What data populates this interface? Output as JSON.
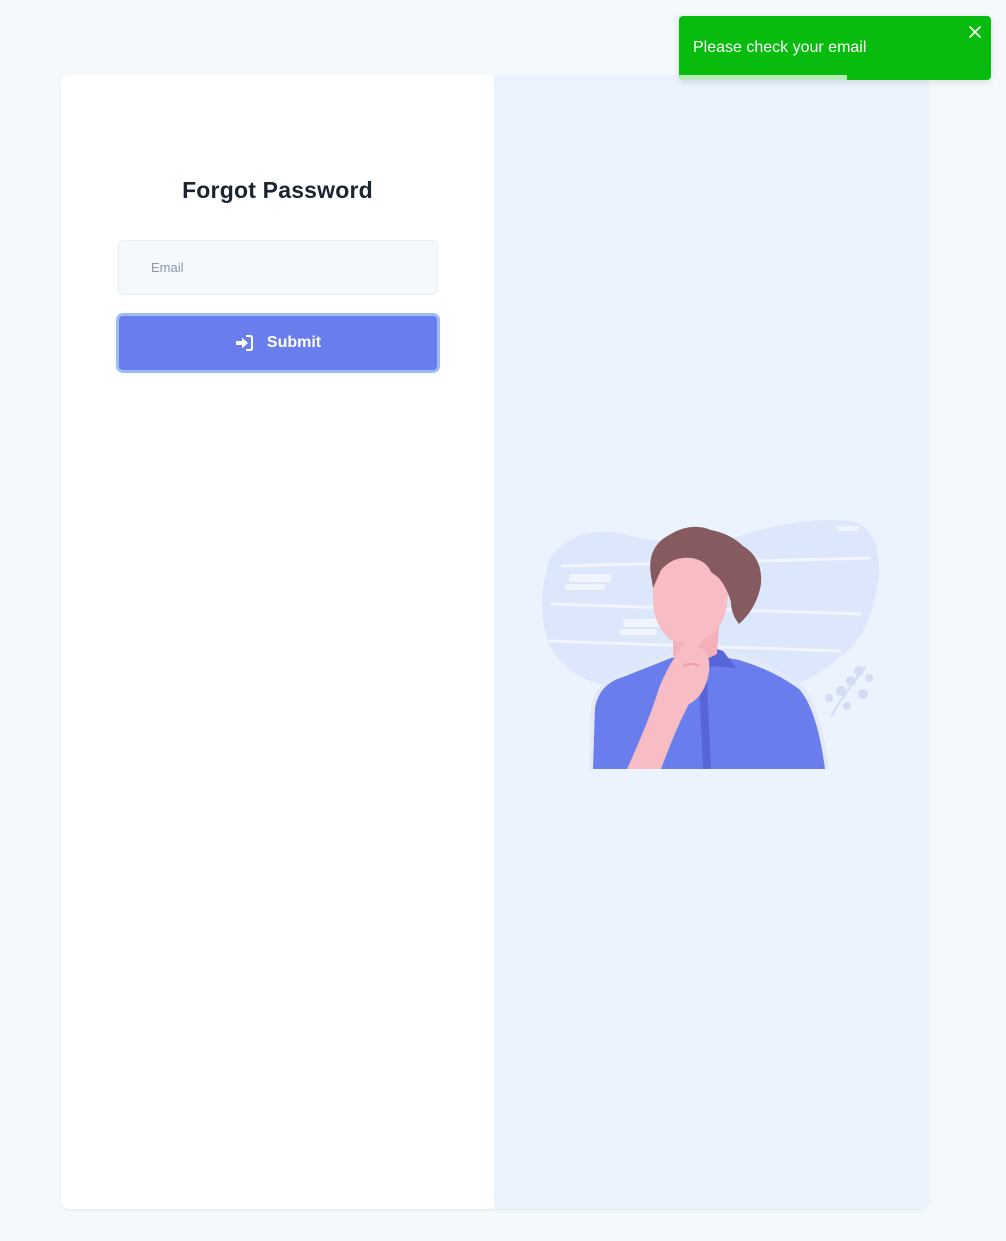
{
  "form": {
    "title": "Forgot Password",
    "email_placeholder": "Email",
    "email_value": "",
    "submit_label": "Submit",
    "submit_icon": "sign-in-icon"
  },
  "toast": {
    "message": "Please check your email",
    "type": "success",
    "progress_remaining": 0.54,
    "close_icon": "close-icon"
  },
  "illustration": {
    "subject": "thinking-person-illustration"
  },
  "colors": {
    "page_background": "#f5f9fc",
    "right_panel": "#ebf3fe",
    "accent": "#6a7ded",
    "toast_success": "#07bc0c",
    "title_text": "#1b2431"
  }
}
